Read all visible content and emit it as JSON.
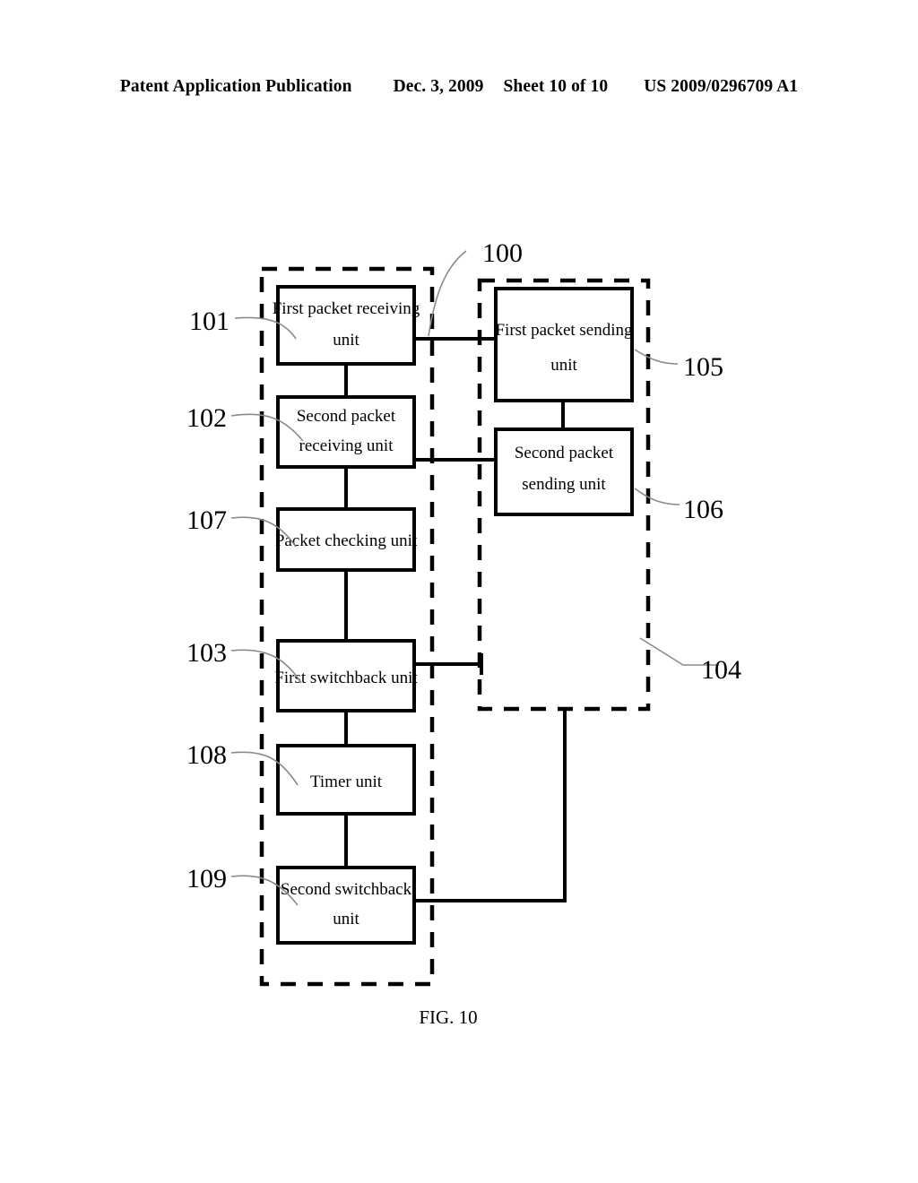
{
  "header": {
    "publication": "Patent Application Publication",
    "date": "Dec. 3, 2009",
    "sheet": "Sheet 10 of 10",
    "docnum": "US 2009/0296709 A1"
  },
  "figure": {
    "caption": "FIG. 10",
    "system_label": "100",
    "left_group_ref": "",
    "right_group_ref": "104"
  },
  "blocks": {
    "b101": {
      "ref": "101",
      "label_line1": "First packet receiving",
      "label_line2": "unit"
    },
    "b102": {
      "ref": "102",
      "label_line1": "Second packet",
      "label_line2": "receiving unit"
    },
    "b107": {
      "ref": "107",
      "label_line1": "Packet checking unit",
      "label_line2": ""
    },
    "b103": {
      "ref": "103",
      "label_line1": "First switchback unit",
      "label_line2": ""
    },
    "b108": {
      "ref": "108",
      "label_line1": "Timer unit",
      "label_line2": ""
    },
    "b109": {
      "ref": "109",
      "label_line1": "Second switchback",
      "label_line2": "unit"
    },
    "b105": {
      "ref": "105",
      "label_line1": "First packet sending",
      "label_line2": "unit"
    },
    "b106": {
      "ref": "106",
      "label_line1": "Second packet",
      "label_line2": "sending unit"
    }
  },
  "colors": {
    "ink": "#000000",
    "leader": "#8a8a8a",
    "paper": "#ffffff"
  }
}
